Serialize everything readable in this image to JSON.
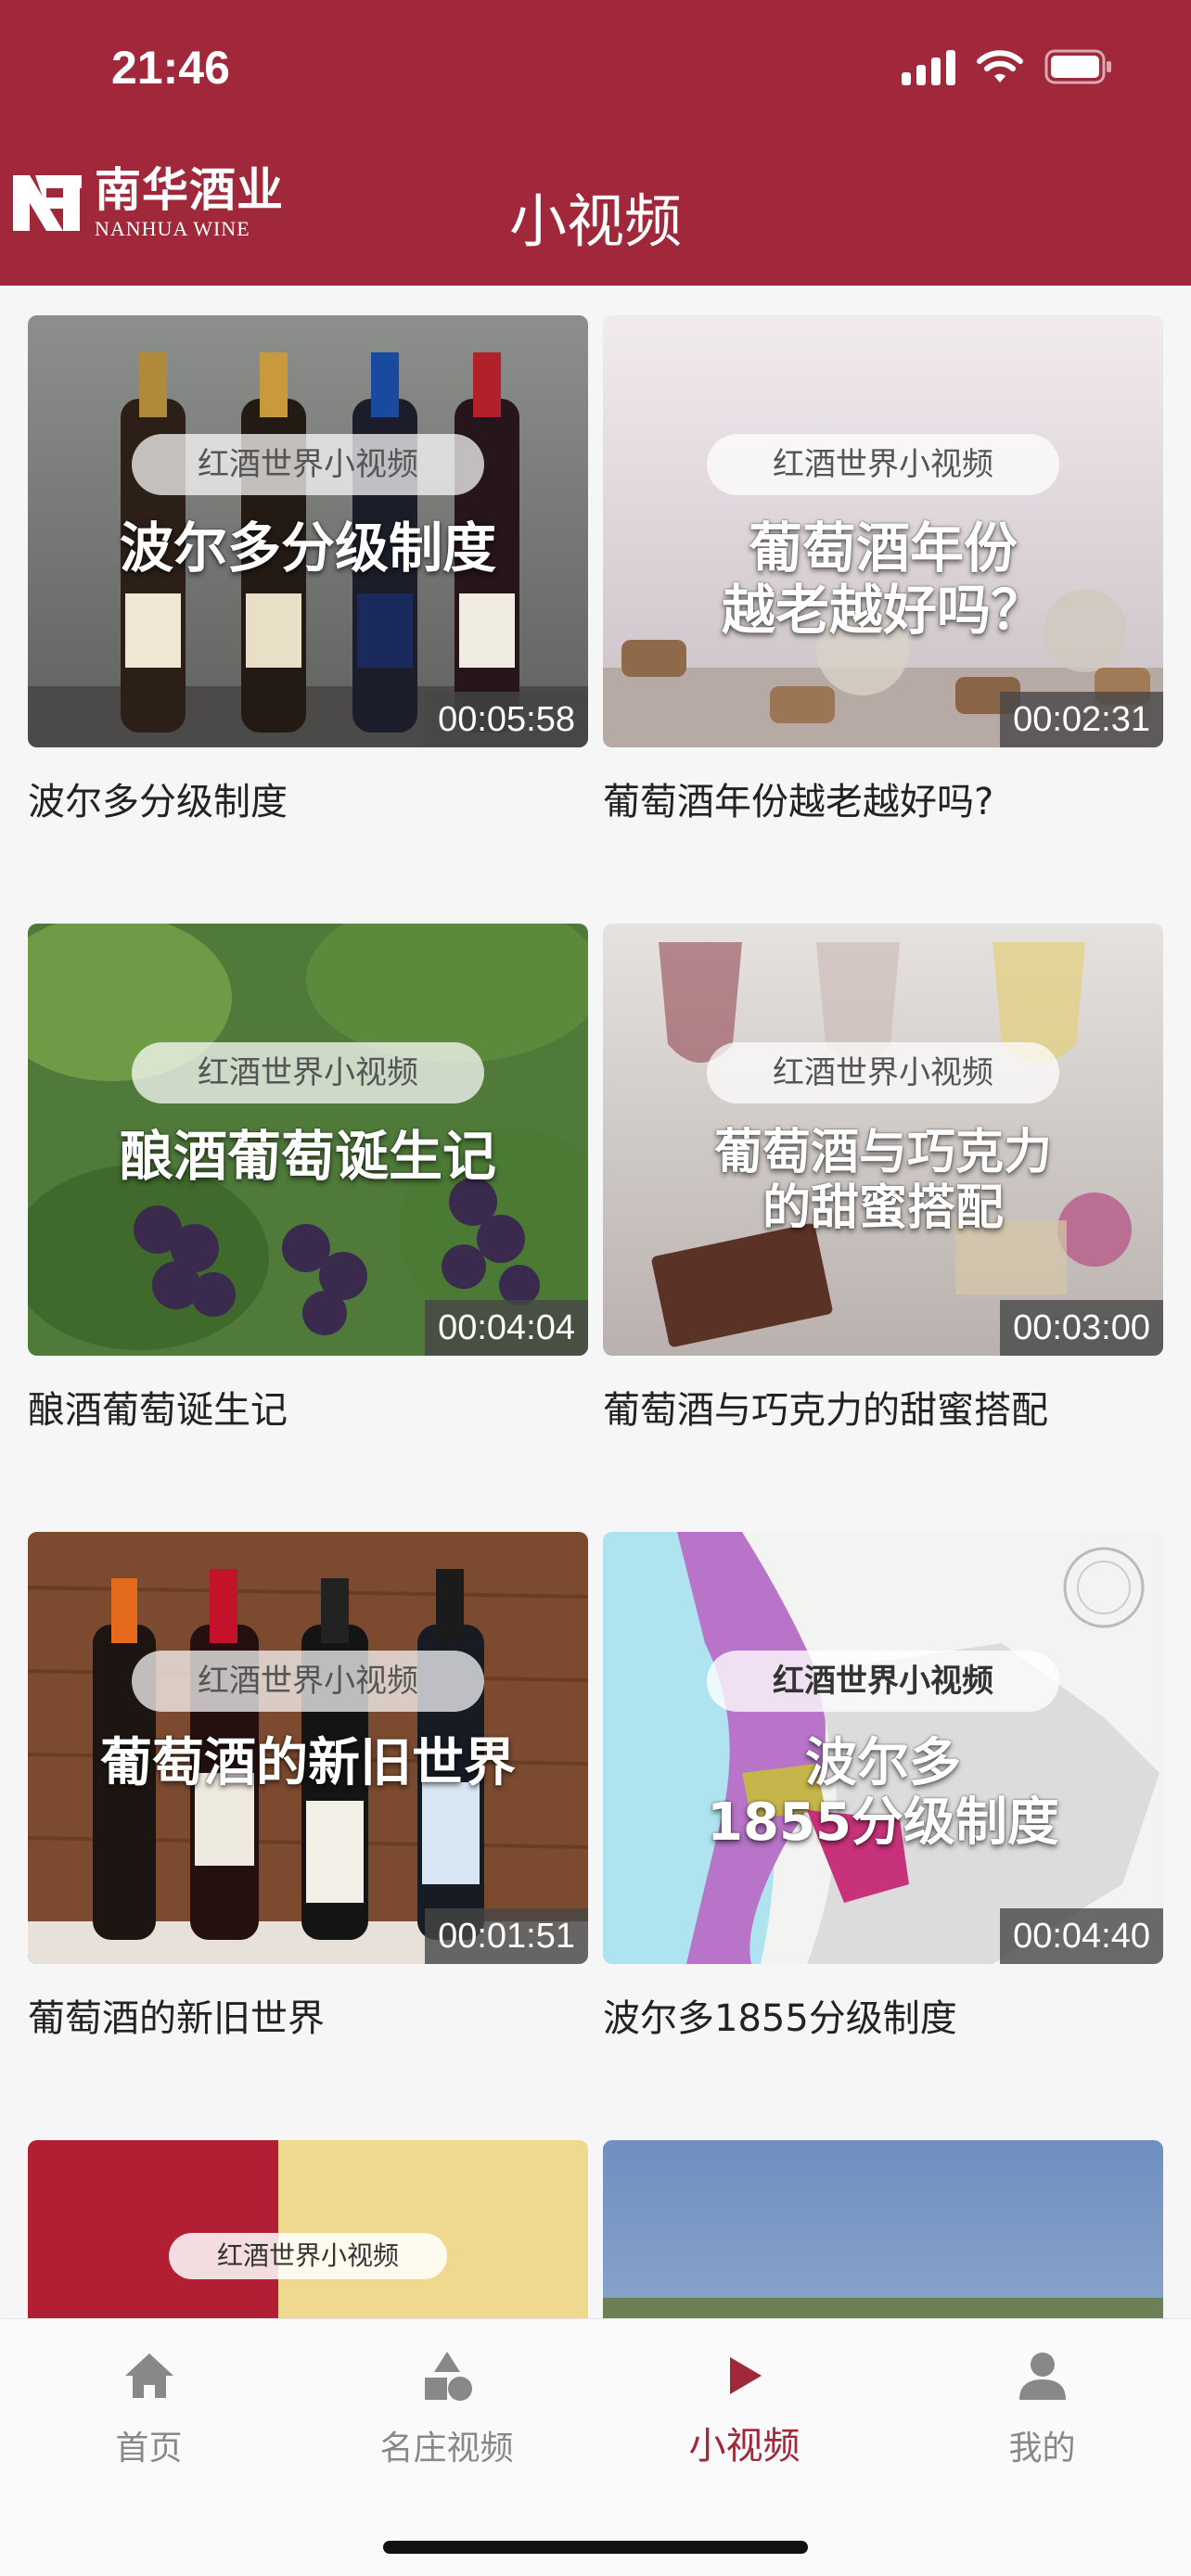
{
  "status_bar": {
    "time": "21:46"
  },
  "header": {
    "logo_cn": "南华酒业",
    "logo_en": "NANHUA WINE",
    "title": "小视频"
  },
  "videos": [
    {
      "badge": "红酒世界小视频",
      "headline": "波尔多分级制度",
      "duration": "00:05:58",
      "title": "波尔多分级制度"
    },
    {
      "badge": "红酒世界小视频",
      "headline": "葡萄酒年份\n越老越好吗？",
      "duration": "00:02:31",
      "title": "葡萄酒年份越老越好吗?"
    },
    {
      "badge": "红酒世界小视频",
      "headline": "酿酒葡萄诞生记",
      "duration": "00:04:04",
      "title": "酿酒葡萄诞生记"
    },
    {
      "badge": "红酒世界小视频",
      "headline": "葡萄酒与巧克力\n的甜蜜搭配",
      "duration": "00:03:00",
      "title": "葡萄酒与巧克力的甜蜜搭配"
    },
    {
      "badge": "红酒世界小视频",
      "headline": "葡萄酒的新旧世界",
      "duration": "00:01:51",
      "title": "葡萄酒的新旧世界"
    },
    {
      "badge": "红酒世界小视频",
      "headline": "波尔多\n1855分级制度",
      "duration": "00:04:40",
      "title": "波尔多1855分级制度"
    },
    {
      "badge": "红酒世界小视频"
    }
  ],
  "tabs": [
    {
      "label": "首页",
      "icon": "home-icon"
    },
    {
      "label": "名庄视频",
      "icon": "shapes-icon"
    },
    {
      "label": "小视频",
      "icon": "play-icon",
      "active": true
    },
    {
      "label": "我的",
      "icon": "user-icon"
    }
  ],
  "colors": {
    "brand": "#a0283a",
    "inactive": "#888888"
  }
}
